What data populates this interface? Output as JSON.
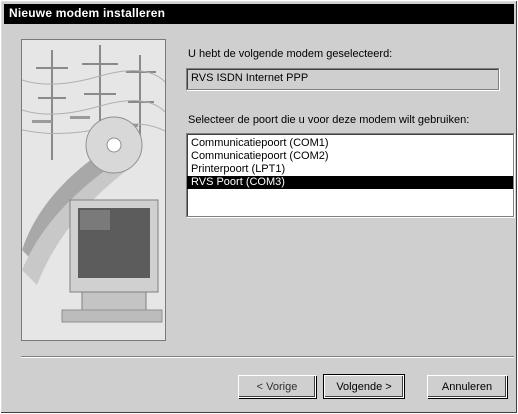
{
  "window": {
    "title": "Nieuwe modem installeren"
  },
  "selected_modem": {
    "label": "U hebt de volgende modem geselecteerd:",
    "value": "RVS ISDN Internet PPP"
  },
  "ports": {
    "label": "Selecteer de poort die u voor deze modem wilt gebruiken:",
    "items": [
      "Communicatiepoort (COM1)",
      "Communicatiepoort (COM2)",
      "Printerpoort (LPT1)",
      "RVS Poort (COM3)"
    ],
    "selected_index": 3
  },
  "buttons": {
    "back": "< Vorige",
    "next": "Volgende >",
    "cancel": "Annuleren"
  },
  "colors": {
    "dialog_bg": "#cfcfcf",
    "titlebar": "#000000",
    "selection": "#000000"
  }
}
